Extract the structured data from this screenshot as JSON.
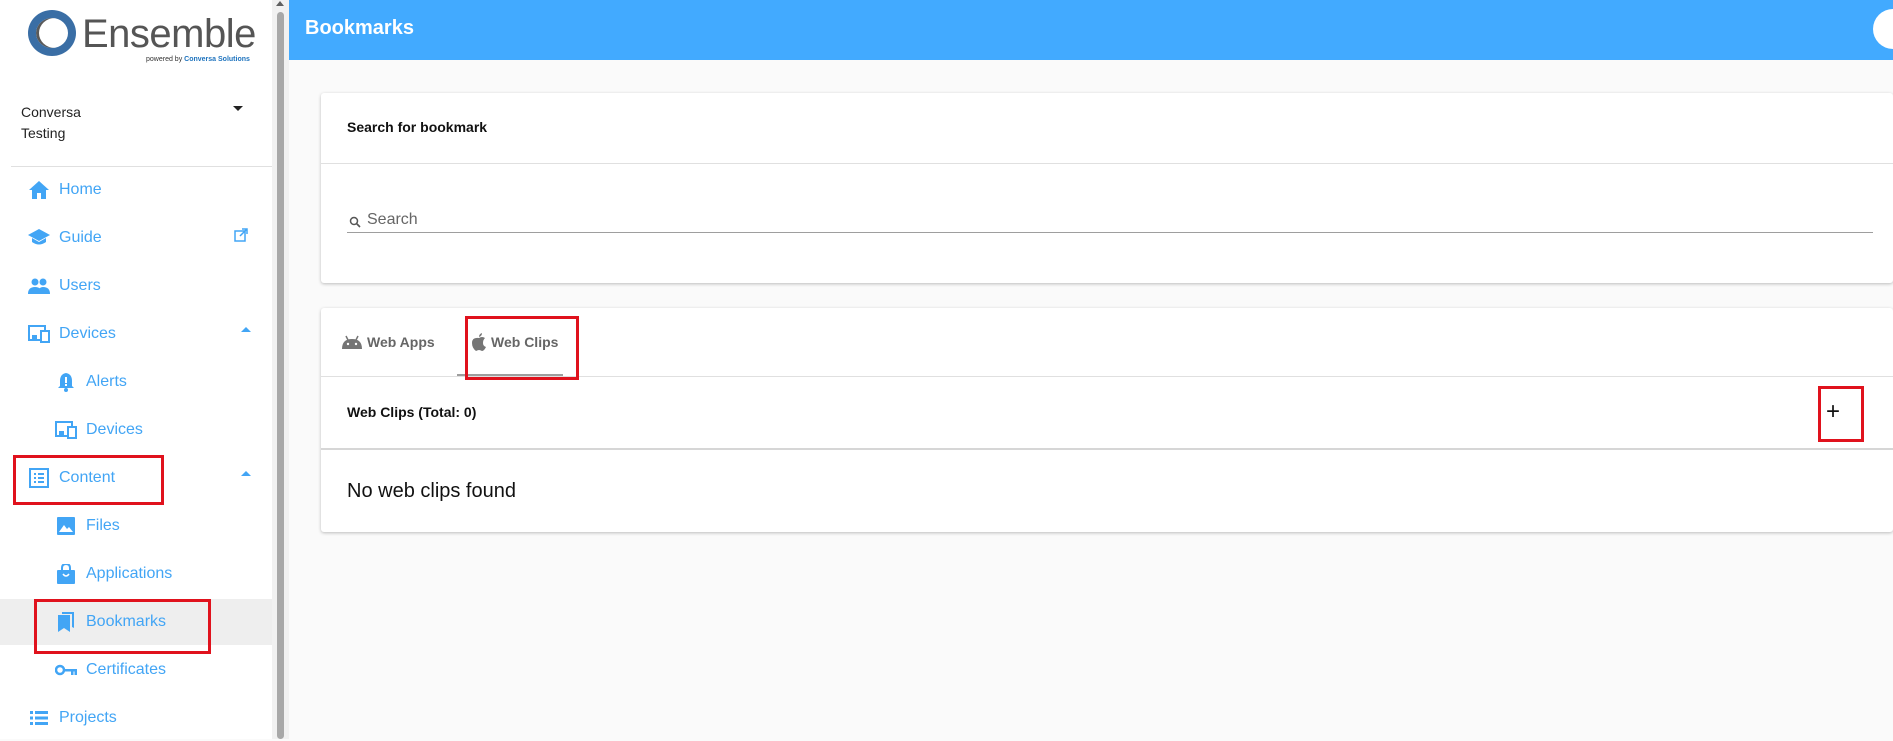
{
  "brand": {
    "name": "Ensemble",
    "powered_prefix": "powered by",
    "powered_company": "Conversa Solutions"
  },
  "org": {
    "line1": "Conversa",
    "line2": "Testing"
  },
  "nav": {
    "home": "Home",
    "guide": "Guide",
    "users": "Users",
    "devices": "Devices",
    "alerts": "Alerts",
    "devices_sub": "Devices",
    "content": "Content",
    "files": "Files",
    "applications": "Applications",
    "bookmarks": "Bookmarks",
    "certificates": "Certificates",
    "projects": "Projects"
  },
  "header": {
    "title": "Bookmarks"
  },
  "search_card": {
    "heading": "Search for bookmark",
    "placeholder": "Search"
  },
  "tabs": {
    "web_apps": "Web Apps",
    "web_clips": "Web Clips"
  },
  "clips": {
    "heading": "Web Clips (Total: 0)",
    "add_symbol": "+",
    "empty_message": "No web clips found"
  },
  "colors": {
    "accent": "#42aaff",
    "nav_text": "#42a5f5",
    "highlight": "#e0121d"
  }
}
